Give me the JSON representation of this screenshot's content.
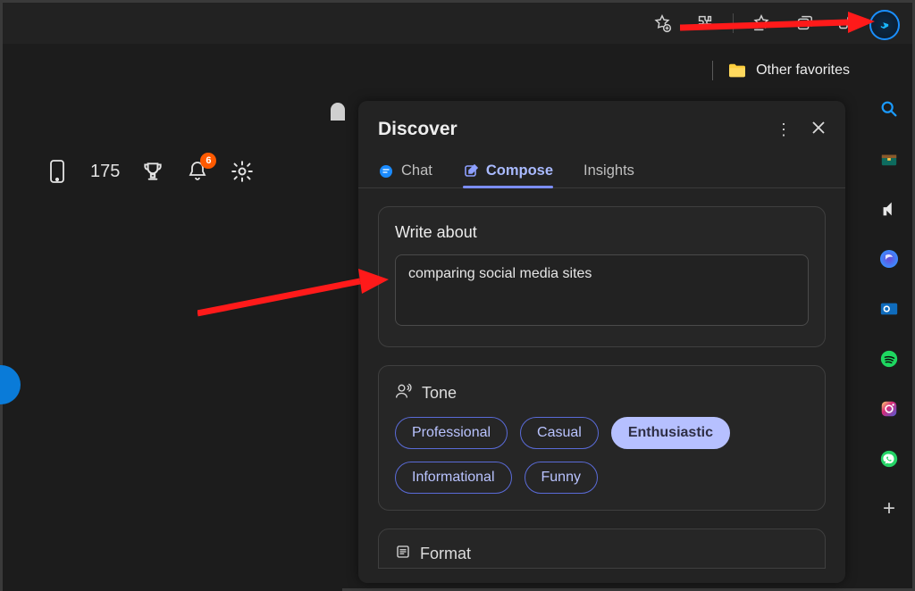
{
  "toolbar": {
    "icons": [
      "star-plus",
      "extensions",
      "favorites-star",
      "collections",
      "share"
    ]
  },
  "favorites": {
    "label": "Other favorites"
  },
  "rewards": {
    "points": "175",
    "notifications": "6"
  },
  "sidebar_items": [
    "search-icon",
    "shopping-icon",
    "games-icon",
    "office-icon",
    "outlook-icon",
    "spotify-icon",
    "instagram-icon",
    "whatsapp-icon",
    "add-icon"
  ],
  "discover": {
    "title": "Discover",
    "tabs": {
      "chat": "Chat",
      "compose": "Compose",
      "insights": "Insights",
      "active": "compose"
    },
    "compose": {
      "write_about_label": "Write about",
      "write_about_value": "comparing social media sites",
      "tone_label": "Tone",
      "tones": [
        {
          "label": "Professional",
          "selected": false
        },
        {
          "label": "Casual",
          "selected": false
        },
        {
          "label": "Enthusiastic",
          "selected": true
        },
        {
          "label": "Informational",
          "selected": false
        },
        {
          "label": "Funny",
          "selected": false
        }
      ],
      "format_label": "Format"
    }
  }
}
